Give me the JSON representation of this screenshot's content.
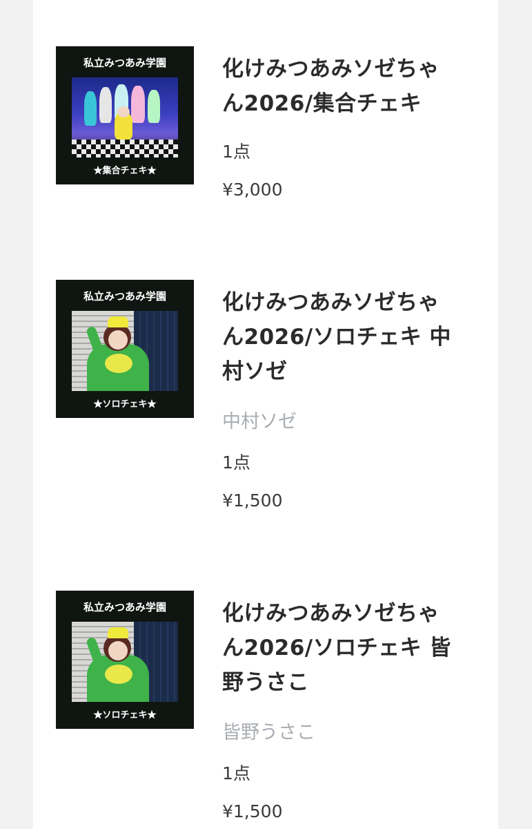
{
  "items": [
    {
      "thumb_school": "私立みつあみ学園",
      "thumb_caption": "★集合チェキ★",
      "title": "化けみつあみソゼちゃん2026/集合チェキ",
      "member": "",
      "quantity": "1点",
      "price": "¥3,000"
    },
    {
      "thumb_school": "私立みつあみ学園",
      "thumb_caption": "★ソロチェキ★",
      "title": "化けみつあみソゼちゃん2026/ソロチェキ 中村ソゼ",
      "member": "中村ソゼ",
      "quantity": "1点",
      "price": "¥1,500"
    },
    {
      "thumb_school": "私立みつあみ学園",
      "thumb_caption": "★ソロチェキ★",
      "title": "化けみつあみソゼちゃん2026/ソロチェキ 皆野うさこ",
      "member": "皆野うさこ",
      "quantity": "1点",
      "price": "¥1,500"
    }
  ]
}
